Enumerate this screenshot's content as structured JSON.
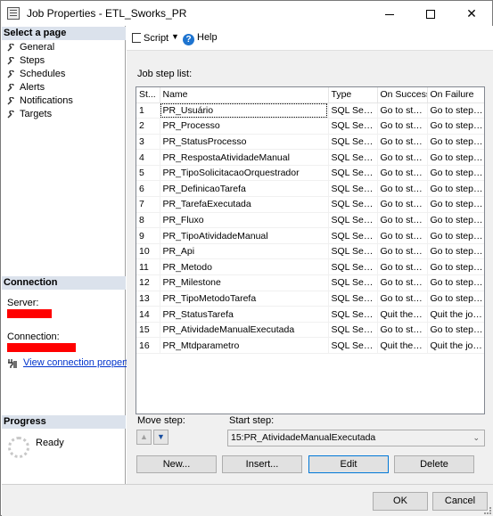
{
  "window": {
    "title": "Job Properties - ETL_Sworks_PR"
  },
  "left": {
    "select_page_header": "Select a page",
    "pages": [
      "General",
      "Steps",
      "Schedules",
      "Alerts",
      "Notifications",
      "Targets"
    ],
    "connection_header": "Connection",
    "server_label": "Server:",
    "connection_label": "Connection:",
    "view_connection_link": "View connection properties",
    "progress_header": "Progress",
    "progress_status": "Ready"
  },
  "toolbar": {
    "script_label": "Script",
    "help_label": "Help"
  },
  "steps": {
    "list_label": "Job step list:",
    "columns": [
      "St...",
      "Name",
      "Type",
      "On Success",
      "On Failure"
    ],
    "rows": [
      [
        "1",
        "PR_Usuário",
        "SQL Serv...",
        "Go to ste...",
        "Go to step:..."
      ],
      [
        "2",
        "PR_Processo",
        "SQL Serv...",
        "Go to ste...",
        "Go to step:..."
      ],
      [
        "3",
        "PR_StatusProcesso",
        "SQL Serv...",
        "Go to ste...",
        "Go to step:..."
      ],
      [
        "4",
        "PR_RespostaAtividadeManual",
        "SQL Serv...",
        "Go to ste...",
        "Go to step:..."
      ],
      [
        "5",
        "PR_TipoSolicitacaoOrquestrador",
        "SQL Serv...",
        "Go to ste...",
        "Go to step:..."
      ],
      [
        "6",
        "PR_DefinicaoTarefa",
        "SQL Serv...",
        "Go to ste...",
        "Go to step:..."
      ],
      [
        "7",
        "PR_TarefaExecutada",
        "SQL Serv...",
        "Go to ste...",
        "Go to step:..."
      ],
      [
        "8",
        "PR_Fluxo",
        "SQL Serv...",
        "Go to ste...",
        "Go to step:..."
      ],
      [
        "9",
        "PR_TipoAtividadeManual",
        "SQL Serv...",
        "Go to ste...",
        "Go to step:..."
      ],
      [
        "10",
        "PR_Api",
        "SQL Serv...",
        "Go to ste...",
        "Go to step:..."
      ],
      [
        "11",
        "PR_Metodo",
        "SQL Serv...",
        "Go to ste...",
        "Go to step:..."
      ],
      [
        "12",
        "PR_Milestone",
        "SQL Serv...",
        "Go to ste...",
        "Go to step:..."
      ],
      [
        "13",
        "PR_TipoMetodoTarefa",
        "SQL Serv...",
        "Go to ste...",
        "Go to step:..."
      ],
      [
        "14",
        "PR_StatusTarefa",
        "SQL Serv...",
        "Quit the j...",
        "Quit the job..."
      ],
      [
        "15",
        "PR_AtividadeManualExecutada",
        "SQL Serv...",
        "Go to ste...",
        "Go to step:..."
      ],
      [
        "16",
        "PR_Mtdparametro",
        "SQL Serv...",
        "Quit the j...",
        "Quit the job..."
      ]
    ],
    "move_step_label": "Move step:",
    "start_step_label": "Start step:",
    "start_step_value": "15:PR_AtividadeManualExecutada",
    "buttons": {
      "new": "New...",
      "insert": "Insert...",
      "edit": "Edit",
      "delete": "Delete"
    }
  },
  "footer": {
    "ok": "OK",
    "cancel": "Cancel"
  }
}
